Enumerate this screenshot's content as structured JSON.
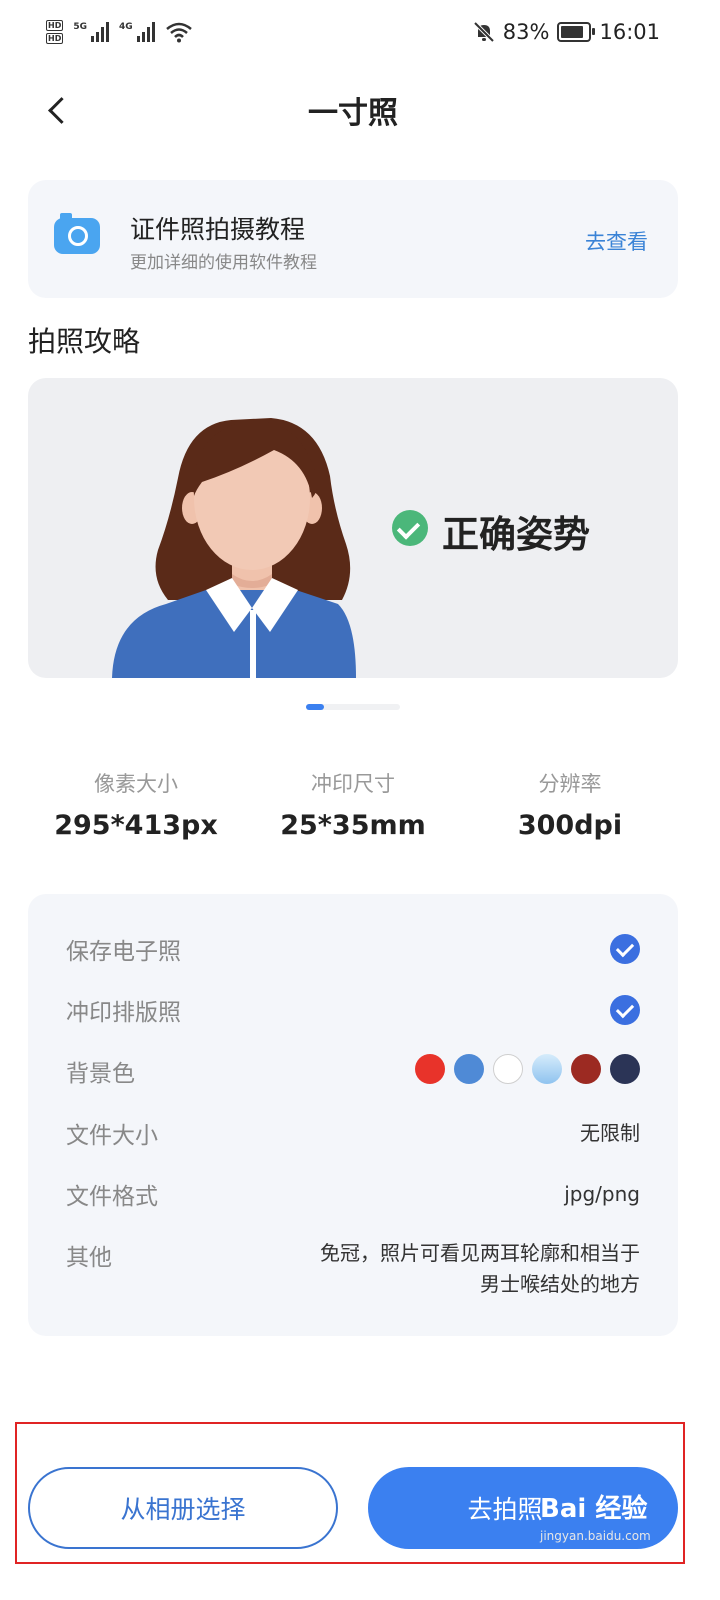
{
  "status_bar": {
    "hd_tags": [
      "HD",
      "HD"
    ],
    "signal_1": "5G",
    "signal_2": "4G",
    "battery_percent": "83%",
    "battery_level": 0.83,
    "time": "16:01",
    "icons": [
      "signal-icon",
      "wifi-icon",
      "mute-bell-icon",
      "battery-icon"
    ]
  },
  "header": {
    "title": "一寸照",
    "back_icon": "back-arrow-icon"
  },
  "tutorial": {
    "title": "证件照拍摄教程",
    "subtitle": "更加详细的使用软件教程",
    "link": "去查看",
    "icon": "camera-icon"
  },
  "guide": {
    "title": "拍照攻略"
  },
  "banner": {
    "text": "正确姿势",
    "icon": "check-circle-icon",
    "page_index": 1,
    "page_count": 5
  },
  "specs": [
    {
      "label": "像素大小",
      "value": "295*413px"
    },
    {
      "label": "冲印尺寸",
      "value": "25*35mm"
    },
    {
      "label": "分辨率",
      "value": "300dpi"
    }
  ],
  "details": {
    "save_digital": {
      "label": "保存电子照",
      "checked": true
    },
    "print_layout": {
      "label": "冲印排版照",
      "checked": true
    },
    "background": {
      "label": "背景色",
      "colors": [
        "#e8332a",
        "#4f8ad6",
        "#ffffff",
        "#a9d1f3",
        "#9c2a22",
        "#2b3456"
      ]
    },
    "file_size": {
      "label": "文件大小",
      "value": "无限制"
    },
    "file_format": {
      "label": "文件格式",
      "value": "jpg/png"
    },
    "other": {
      "label": "其他",
      "value_line1": "免冠，照片可看见两耳轮廓和相当于",
      "value_line2": "男士喉结处的地方"
    }
  },
  "actions": {
    "album": "从相册选择",
    "shoot": "去拍照"
  },
  "watermark": {
    "logo": "Bai 经验",
    "url": "jingyan.baidu.com"
  },
  "colors": {
    "accent": "#3b80f0",
    "link": "#3a83d6",
    "highlight_frame": "#e02424"
  }
}
